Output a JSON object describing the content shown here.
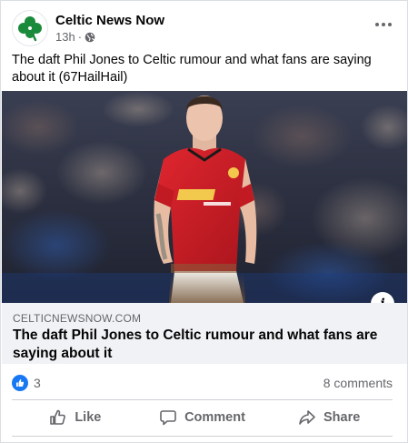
{
  "post": {
    "page_name": "Celtic News Now",
    "time": "13h",
    "separator": "·",
    "text": "The daft Phil Jones to Celtic rumour and what fans are saying about it (67HailHail)"
  },
  "link": {
    "domain": "CELTICNEWSNOW.COM",
    "title": "The daft Phil Jones to Celtic rumour and what fans are saying about it"
  },
  "info_icon_text": "i",
  "reactions": {
    "count": "3",
    "comments": "8 comments"
  },
  "actions": {
    "like": "Like",
    "comment": "Comment",
    "share": "Share"
  },
  "colors": {
    "brand_green": "#1a8a3b",
    "like_blue": "#1877f2",
    "jersey_red": "#d8202a"
  },
  "icons": [
    "clover-logo-icon",
    "globe-icon",
    "more-options-icon",
    "info-icon",
    "like-reaction-icon",
    "thumbs-up-icon",
    "comment-icon",
    "share-icon"
  ]
}
